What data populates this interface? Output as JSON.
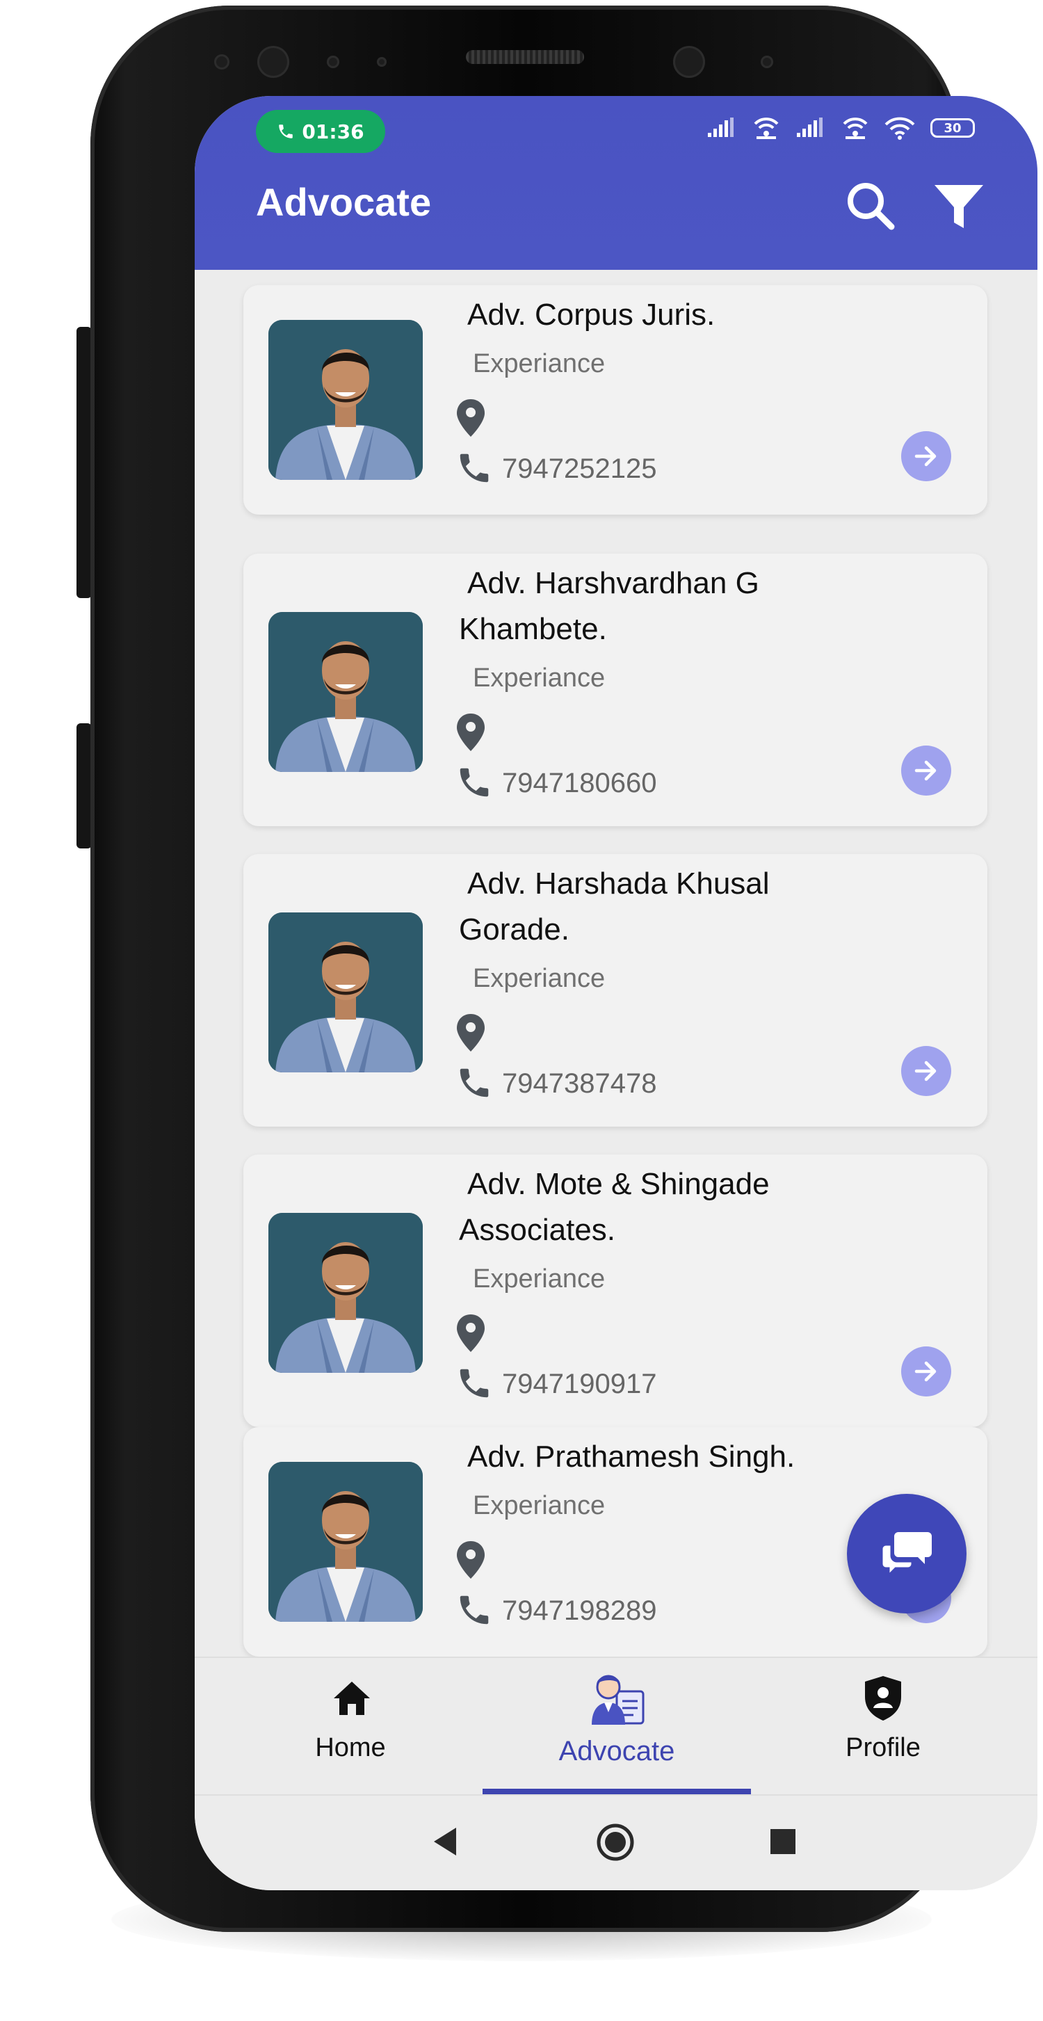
{
  "status_bar": {
    "call_time": "01:36",
    "battery": "30"
  },
  "app_bar": {
    "title": "Advocate",
    "search_icon": "search-icon",
    "filter_icon": "filter-icon"
  },
  "advocates": [
    {
      "name_line1": "Adv. Corpus Juris.",
      "name_line2": "",
      "experience_label": "Experiance",
      "phone": "7947252125"
    },
    {
      "name_line1": "Adv. Harshvardhan G",
      "name_line2": "Khambete.",
      "experience_label": "Experiance",
      "phone": "7947180660"
    },
    {
      "name_line1": "Adv. Harshada Khusal",
      "name_line2": "Gorade.",
      "experience_label": "Experiance",
      "phone": "7947387478"
    },
    {
      "name_line1": "Adv. Mote & Shingade",
      "name_line2": "Associates.",
      "experience_label": "Experiance",
      "phone": "7947190917"
    },
    {
      "name_line1": "Adv. Prathamesh Singh.",
      "name_line2": "",
      "experience_label": "Experiance",
      "phone": "7947198289"
    }
  ],
  "bottom_nav": {
    "items": [
      {
        "label": "Home",
        "icon": "home-icon"
      },
      {
        "label": "Advocate",
        "icon": "advocate-icon",
        "active": true
      },
      {
        "label": "Profile",
        "icon": "profile-shield-icon"
      }
    ]
  },
  "colors": {
    "primary": "#4a53c2",
    "accent": "#3d44b0",
    "arrow_button": "#9fa2ee",
    "call_pill": "#15a862"
  }
}
